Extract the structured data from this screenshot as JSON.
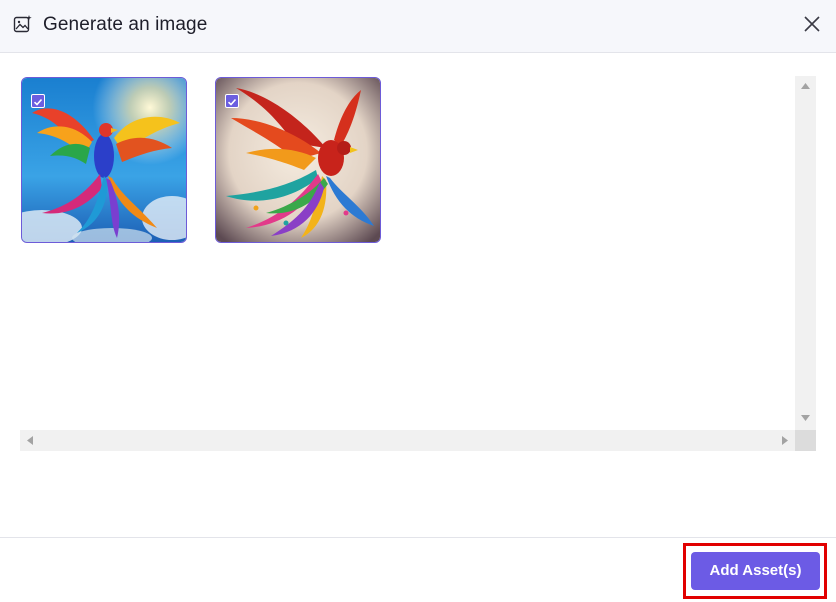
{
  "dialog": {
    "title": "Generate an image",
    "title_icon": "image-sparkle-icon",
    "close_icon": "close-icon"
  },
  "gallery": {
    "images": [
      {
        "name": "generated-image-1",
        "description": "phoenix over blue sky",
        "selected": true
      },
      {
        "name": "generated-image-2",
        "description": "red phoenix with colorful feathers",
        "selected": true
      }
    ]
  },
  "footer": {
    "add_assets_label": "Add Asset(s)"
  },
  "colors": {
    "accent": "#6c5be5",
    "highlight": "#e10000",
    "header_bg": "#f6f7fb"
  }
}
